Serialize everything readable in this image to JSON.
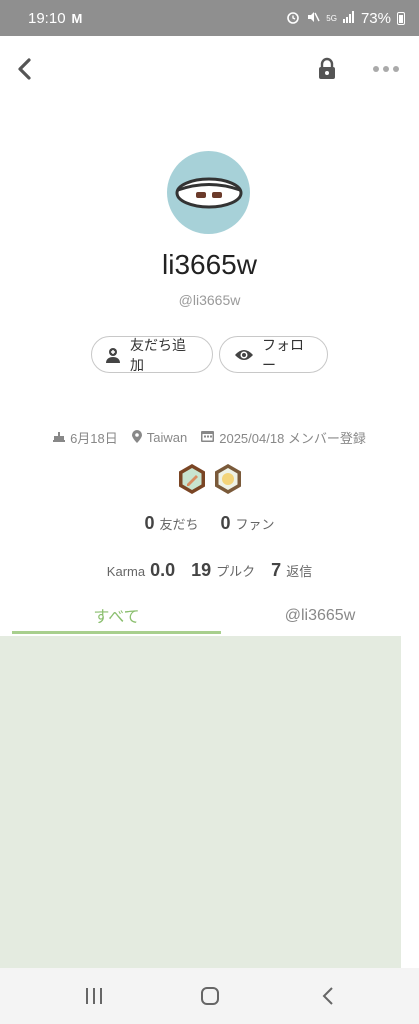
{
  "status_bar": {
    "time": "19:10",
    "mail_icon": "M",
    "signal_text": "5G",
    "battery": "73%"
  },
  "profile": {
    "display_name": "li3665w",
    "handle": "@li3665w",
    "avatar_color": "#a7d1d8"
  },
  "actions": {
    "add_friend_label": "友だち追加",
    "follow_label": "フォロー"
  },
  "meta": {
    "birthday": "6月18日",
    "location": "Taiwan",
    "joined": "2025/04/18 メンバー登録"
  },
  "stats": {
    "friends_count": "0",
    "friends_label": "友だち",
    "fans_count": "0",
    "fans_label": "ファン",
    "karma_label": "Karma",
    "karma_value": "0.0",
    "plurks_count": "19",
    "plurks_label": "プルク",
    "replies_count": "7",
    "replies_label": "返信"
  },
  "tabs": [
    {
      "label": "すべて"
    },
    {
      "label": "@li3665w"
    }
  ],
  "colors": {
    "status_bar": "#8f8f8f",
    "accent": "#8bbf6f",
    "content_bg": "#e4ebe0"
  }
}
